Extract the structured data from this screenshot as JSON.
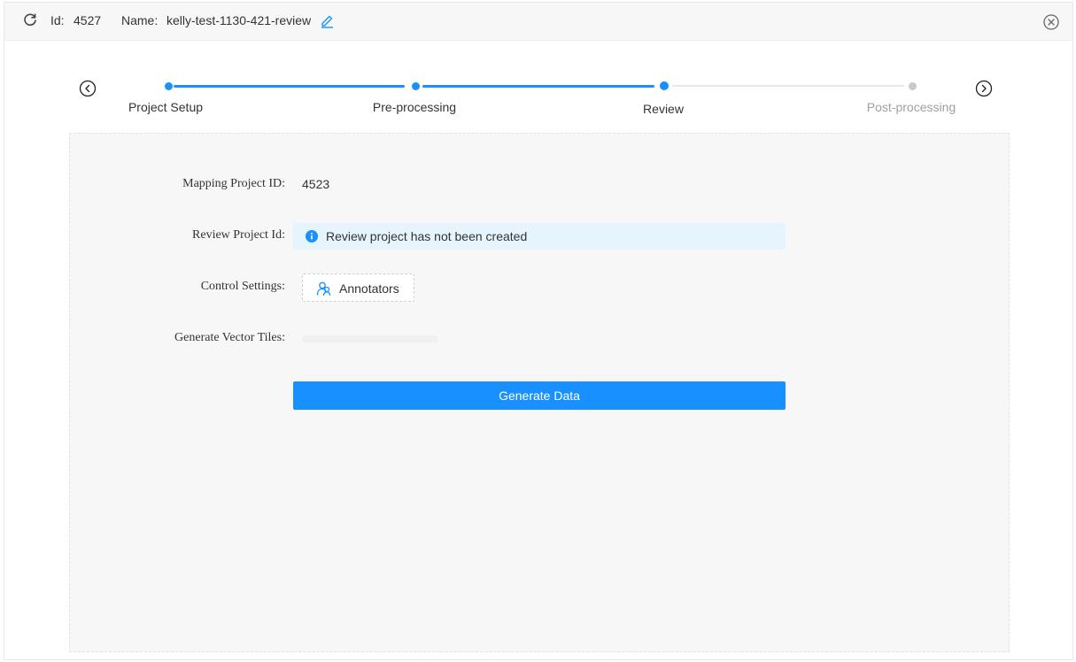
{
  "header": {
    "id_label": "Id:",
    "id_value": "4527",
    "name_label": "Name:",
    "name_value": "kelly-test-1130-421-review"
  },
  "icons": {
    "refresh": "refresh-icon",
    "edit": "edit-icon",
    "close": "close-circle-icon",
    "prev": "chevron-left-circle-icon",
    "next": "chevron-right-circle-icon",
    "info": "info-circle-icon",
    "annotators": "users-icon"
  },
  "steps": [
    {
      "label": "Project Setup",
      "status": "done"
    },
    {
      "label": "Pre-processing",
      "status": "done"
    },
    {
      "label": "Review",
      "status": "current"
    },
    {
      "label": "Post-processing",
      "status": "todo"
    }
  ],
  "form": {
    "mapping_label": "Mapping Project ID:",
    "mapping_value": "4523",
    "review_label": "Review Project Id:",
    "review_info": "Review project has not been created",
    "control_label": "Control Settings:",
    "annotators_button": "Annotators",
    "vector_label": "Generate Vector Tiles:",
    "generate_button": "Generate Data"
  },
  "colors": {
    "primary": "#1890ff",
    "info_bg": "#e6f4fd",
    "inactive": "#c8c8c8"
  }
}
